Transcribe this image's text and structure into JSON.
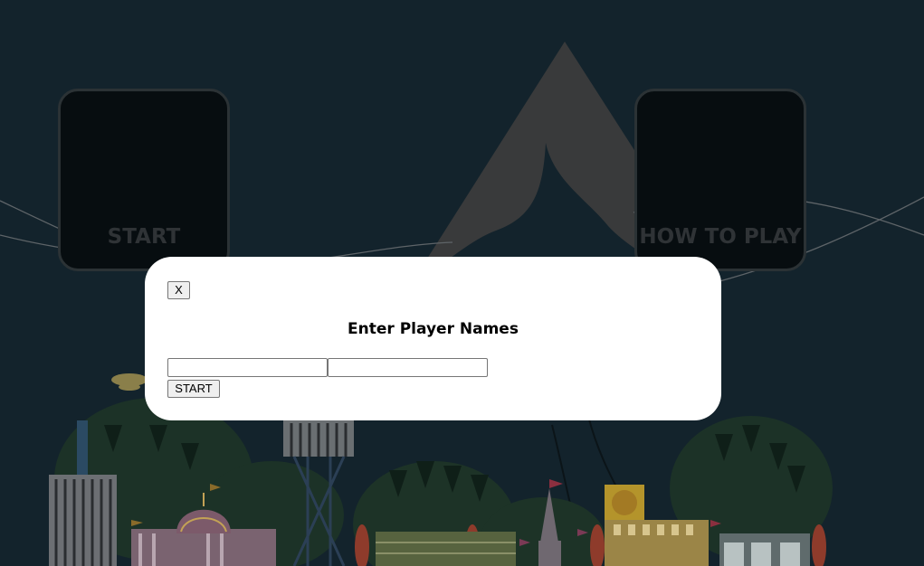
{
  "menu": {
    "start_label": "START",
    "howto_label": "HOW TO PLAY"
  },
  "modal": {
    "close_label": "X",
    "title": "Enter Player Names",
    "player1_value": "",
    "player2_value": "",
    "start_label": "START"
  },
  "colors": {
    "background": "#13232c",
    "tent": "#393a3b",
    "card": "#070d10",
    "card_border": "#2b3235",
    "modal": "#ffffff"
  }
}
